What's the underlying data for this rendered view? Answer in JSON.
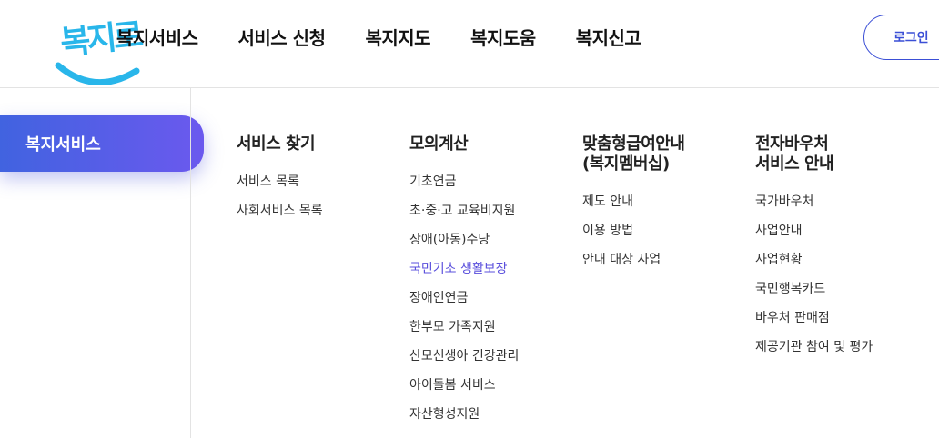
{
  "logo": {
    "text": "복지로",
    "accent": "#29b6ea"
  },
  "gnb": [
    {
      "label": "복지서비스"
    },
    {
      "label": "서비스 신청"
    },
    {
      "label": "복지지도"
    },
    {
      "label": "복지도움"
    },
    {
      "label": "복지신고"
    }
  ],
  "login": {
    "label": "로그인"
  },
  "side": {
    "active_label": "복지서비스"
  },
  "columns": [
    {
      "title": [
        "서비스 찾기"
      ],
      "items": [
        "서비스 목록",
        "사회서비스 목록"
      ],
      "active_index": -1
    },
    {
      "title": [
        "모의계산"
      ],
      "items": [
        "기초연금",
        "초·중·고 교육비지원",
        "장애(아동)수당",
        "국민기초 생활보장",
        "장애인연금",
        "한부모 가족지원",
        "산모신생아 건강관리",
        "아이돌봄 서비스",
        "자산형성지원"
      ],
      "active_index": 3
    },
    {
      "title": [
        "맞춤형급여안내",
        "(복지멤버십)"
      ],
      "items": [
        "제도 안내",
        "이용 방법",
        "안내 대상 사업"
      ],
      "active_index": -1
    },
    {
      "title": [
        "전자바우처",
        "서비스 안내"
      ],
      "items": [
        "국가바우처",
        "사업안내",
        "사업현황",
        "국민행복카드",
        "바우처 판매점",
        "제공기관 참여 및 평가"
      ],
      "active_index": -1
    }
  ],
  "colors": {
    "brand": "#3b4fd6",
    "active_link": "#5a4fdc",
    "pill_start": "#4163e0",
    "pill_end": "#6b59ee"
  }
}
